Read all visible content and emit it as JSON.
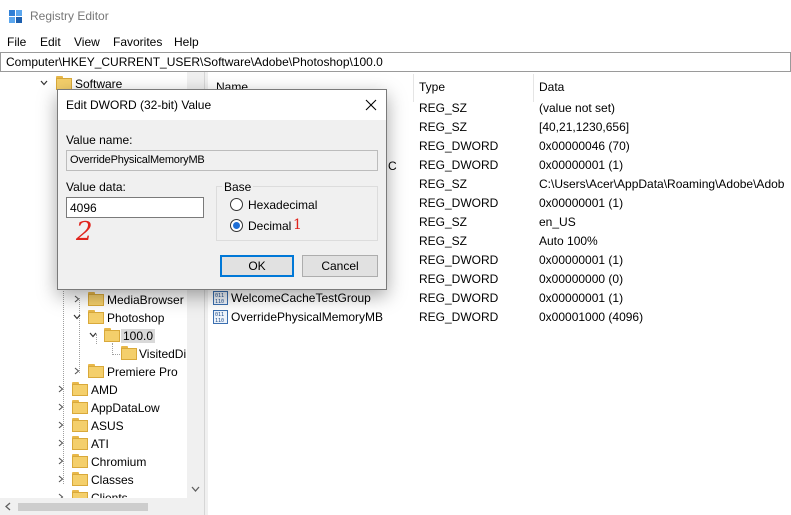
{
  "window": {
    "title": "Registry Editor",
    "icon": "registry-editor-icon"
  },
  "menu": [
    "File",
    "Edit",
    "View",
    "Favorites",
    "Help"
  ],
  "address": {
    "path": "Computer\\HKEY_CURRENT_USER\\Software\\Adobe\\Photoshop\\100.0"
  },
  "tree": {
    "items": [
      {
        "label": "Software",
        "expander": "expanded"
      },
      {
        "label": "MediaBrowser",
        "expander": "collapsed"
      },
      {
        "label": "Photoshop",
        "expander": "expanded"
      },
      {
        "label": "100.0",
        "expander": "expanded",
        "selected": true
      },
      {
        "label": "VisitedDi",
        "expander": "none"
      },
      {
        "label": "Premiere Pro",
        "expander": "collapsed"
      },
      {
        "label": "AMD",
        "expander": "collapsed"
      },
      {
        "label": "AppDataLow",
        "expander": "collapsed"
      },
      {
        "label": "ASUS",
        "expander": "collapsed"
      },
      {
        "label": "ATI",
        "expander": "collapsed"
      },
      {
        "label": "Chromium",
        "expander": "collapsed"
      },
      {
        "label": "Classes",
        "expander": "collapsed"
      },
      {
        "label": "Clients",
        "expander": "collapsed"
      }
    ]
  },
  "list": {
    "columns": [
      "Name",
      "Type",
      "Data"
    ],
    "partial_name": "C",
    "rows": [
      {
        "name": "",
        "type": "REG_SZ",
        "data": "(value not set)"
      },
      {
        "name": "",
        "type": "REG_SZ",
        "data": "[40,21,1230,656]"
      },
      {
        "name": "",
        "type": "REG_DWORD",
        "data": "0x00000046 (70)"
      },
      {
        "name": "",
        "type": "REG_DWORD",
        "data": "0x00000001 (1)"
      },
      {
        "name": "",
        "type": "REG_SZ",
        "data": "C:\\Users\\Acer\\AppData\\Roaming\\Adobe\\Adob"
      },
      {
        "name": "",
        "type": "REG_DWORD",
        "data": "0x00000001 (1)"
      },
      {
        "name": "",
        "type": "REG_SZ",
        "data": "en_US"
      },
      {
        "name": "",
        "type": "REG_SZ",
        "data": "Auto 100%"
      },
      {
        "name": "",
        "type": "REG_DWORD",
        "data": "0x00000001 (1)"
      },
      {
        "name": "",
        "type": "REG_DWORD",
        "data": "0x00000000 (0)"
      },
      {
        "name": "WelcomeCacheTestGroup",
        "type": "REG_DWORD",
        "data": "0x00000001 (1)"
      },
      {
        "name": "OverridePhysicalMemoryMB",
        "type": "REG_DWORD",
        "data": "0x00001000 (4096)"
      }
    ]
  },
  "dialog": {
    "title": "Edit DWORD (32-bit) Value",
    "value_name_label": "Value name:",
    "value_name": "OverridePhysicalMemoryMB",
    "value_data_label": "Value data:",
    "value_data": "4096",
    "base_label": "Base",
    "base_options": [
      "Hexadecimal",
      "Decimal"
    ],
    "base_selected": "Decimal",
    "ok_label": "OK",
    "cancel_label": "Cancel"
  },
  "annotations": {
    "one": "1",
    "two": "2",
    "color": "#e0241c"
  },
  "colors": {
    "accent": "#0078d7",
    "folder": "#f4cf6b",
    "selection": "#d9d9d9"
  }
}
